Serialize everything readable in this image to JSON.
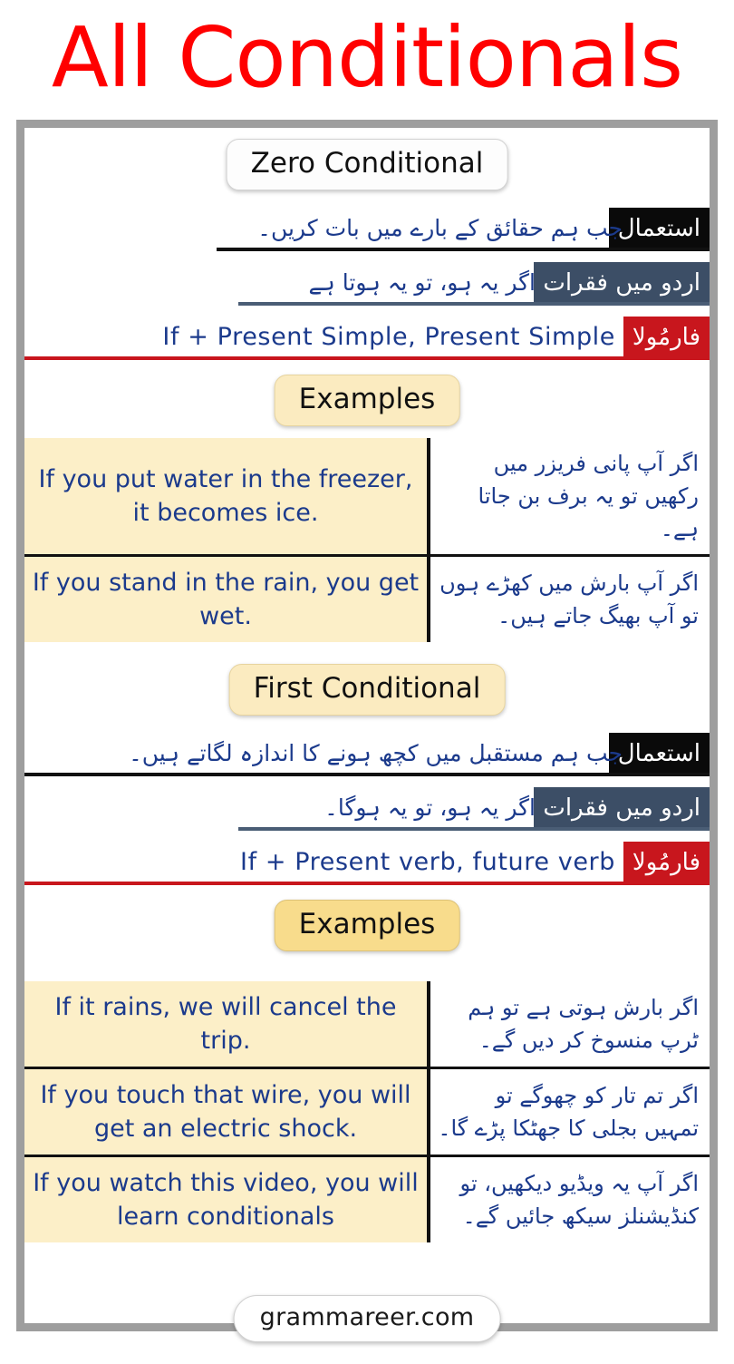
{
  "title": "All Conditionals",
  "footer": {
    "site_label": "grammareer.com"
  },
  "sections": [
    {
      "heading": "Zero Conditional",
      "heading_style": "white",
      "usage_label": "استعمال",
      "usage_value": "جب ہم حقائق کے بارے میں بات کریں۔",
      "urdu_sentence_label": "اردو میں فقرات",
      "urdu_sentence_value": "اگر یہ ہو، تو یہ ہوتا ہے",
      "formula_label": "فارمُولا",
      "formula_value": "If + Present Simple, Present Simple",
      "examples_heading": "Examples",
      "examples_heading_style": "cream",
      "examples": [
        {
          "english": "If you put water in the freezer, it becomes ice.",
          "urdu": "اگر آپ پانی فریزر میں رکھیں تو یہ برف بن جاتا ہے۔"
        },
        {
          "english": "If you stand in the rain, you get wet.",
          "urdu": "اگر آپ بارش میں کھڑے ہوں تو آپ بھیگ جاتے ہیں۔"
        }
      ]
    },
    {
      "heading": "First Conditional",
      "heading_style": "cream",
      "usage_label": "استعمال",
      "usage_value": "جب ہم مستقبل میں کچھ ہونے کا اندازہ لگاتے ہیں۔",
      "urdu_sentence_label": "اردو میں فقرات",
      "urdu_sentence_value": "اگر یہ ہو، تو یہ ہوگا۔",
      "formula_label": "فارمُولا",
      "formula_value": "If + Present verb, future verb",
      "examples_heading": "Examples",
      "examples_heading_style": "yellow",
      "examples": [
        {
          "english": "If it rains, we will cancel the trip.",
          "urdu": "اگر بارش ہوتی ہے تو ہم ٹرپ منسوخ کر دیں گے۔"
        },
        {
          "english": "If you touch that wire, you will get an electric shock.",
          "urdu": "اگر تم تار کو چھوگے تو تمہیں بجلی کا جھٹکا پڑے گا۔"
        },
        {
          "english": "If you watch this video, you will learn conditionals",
          "urdu": "اگر آپ یہ ویڈیو دیکھیں، تو کنڈیشنلز سیکھ جائیں گے۔"
        }
      ]
    }
  ],
  "colors": {
    "title_red": "#FF0000",
    "badge_black": "#0A0A0A",
    "badge_slate": "#3C4E66",
    "badge_red": "#C8161D",
    "cell_cream": "#FCEFC8",
    "text_navy": "#1B3A8C",
    "frame_gray": "#9E9E9E"
  }
}
